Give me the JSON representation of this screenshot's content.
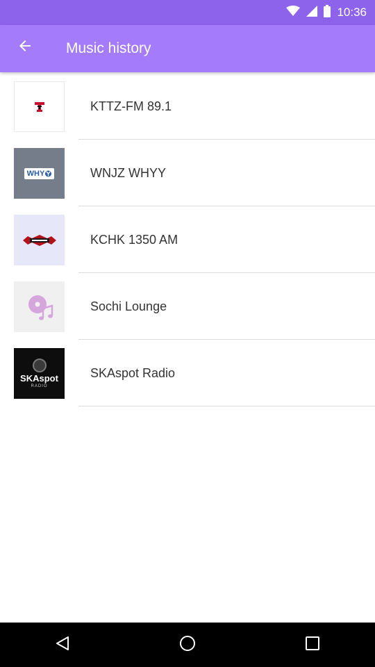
{
  "status_bar": {
    "time": "10:36"
  },
  "app_bar": {
    "title": "Music history"
  },
  "stations": [
    {
      "name": "KTTZ-FM 89.1"
    },
    {
      "name": "WNJZ WHYY",
      "logo_text": "WHY"
    },
    {
      "name": "KCHK 1350 AM"
    },
    {
      "name": "Sochi Lounge"
    },
    {
      "name": "SKAspot Radio",
      "logo_text": "SKAspot",
      "logo_subtext": "RADIO"
    }
  ],
  "colors": {
    "status_bar": "#8e63ec",
    "app_bar": "#a47bfb",
    "nav_bar": "#000000"
  }
}
